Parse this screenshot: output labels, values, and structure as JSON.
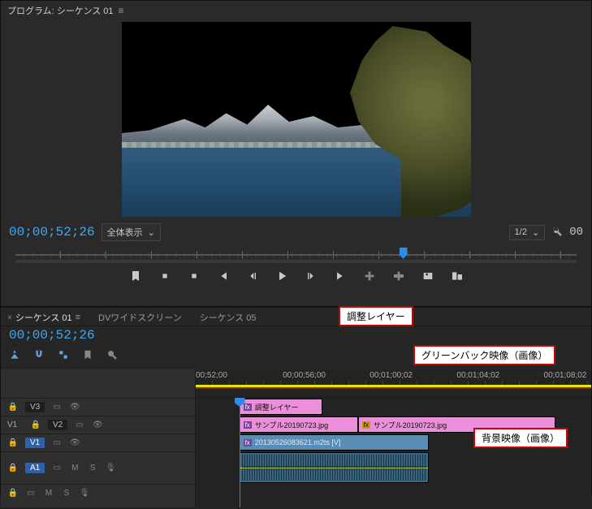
{
  "program": {
    "title": "プログラム: シーケンス 01",
    "menu_glyph": "≡",
    "timecode": "00;00;52;26",
    "fit_label": "全体表示",
    "scale_label": "1/2",
    "right_tc_partial": "00",
    "chevron": "⌄"
  },
  "transport_icons": [
    "marker-add",
    "mark-in",
    "mark-out",
    "goto-in",
    "step-back",
    "play",
    "step-fwd",
    "goto-out",
    "lift",
    "extract",
    "export-frame",
    "comparison"
  ],
  "timeline": {
    "tabs": [
      {
        "label": "シーケンス 01",
        "active": true
      },
      {
        "label": "DVワイドスクリーン",
        "active": false
      },
      {
        "label": "シーケンス 05",
        "active": false
      }
    ],
    "timecode": "00;00;52;26",
    "toolbar": [
      "snow",
      "magnet",
      "link",
      "marker",
      "wrench"
    ],
    "ruler": [
      "00;52;00",
      "00;00;56;00",
      "00;01;00;02",
      "00;01;04;02",
      "00;01;08;02"
    ],
    "playhead_pct": 11,
    "tracks": {
      "left_v1_label": "V1",
      "v3": {
        "label": "V3"
      },
      "v2": {
        "label": "V2"
      },
      "v1": {
        "label": "V1"
      },
      "a1": {
        "label": "A1"
      },
      "a1_pre": "A1",
      "mix": {
        "M": "M",
        "S": "S"
      }
    },
    "clips": {
      "adj": {
        "fx": "fx",
        "name": "調整レイヤー"
      },
      "s1": {
        "fx": "fx",
        "name": "サンプル20190723.jpg"
      },
      "s2": {
        "fx": "fx",
        "name": "サンプル20190723.jpg"
      },
      "bg": {
        "fx": "fx",
        "name": "20130526083621.m2ts [V]"
      }
    }
  },
  "annotations": {
    "adj": "調整レイヤー",
    "green": "グリーンバック映像（画像）",
    "bg": "背景映像（画像）"
  }
}
